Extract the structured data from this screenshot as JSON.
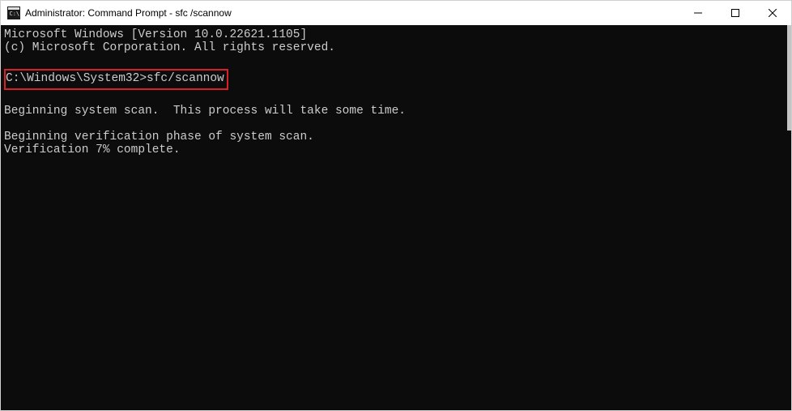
{
  "titlebar": {
    "title": "Administrator: Command Prompt - sfc /scannow"
  },
  "windowControls": {
    "minimize": "minimize",
    "maximize": "maximize",
    "close": "close"
  },
  "terminal": {
    "line1": "Microsoft Windows [Version 10.0.22621.1105]",
    "line2": "(c) Microsoft Corporation. All rights reserved.",
    "prompt": "C:\\Windows\\System32>",
    "command": "sfc/scannow",
    "line3": "Beginning system scan.  This process will take some time.",
    "line4": "Beginning verification phase of system scan.",
    "line5": "Verification 7% complete."
  },
  "highlight": {
    "color": "#d72028"
  }
}
